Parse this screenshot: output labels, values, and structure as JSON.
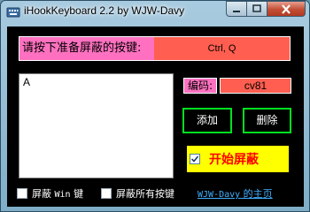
{
  "window": {
    "title": "iHookKeyboard 2.2 by WJW-Davy"
  },
  "titlebar_icons": {
    "min": "minimize-icon",
    "max": "maximize-icon",
    "close": "close-icon"
  },
  "block": {
    "prompt_label": "请按下准备屏蔽的按键:",
    "hotkey_value": "Ctrl, Q"
  },
  "key_list": {
    "items": [
      "A"
    ]
  },
  "code": {
    "label": "编码:",
    "value": "cv81"
  },
  "buttons": {
    "add": "添加",
    "delete": "删除"
  },
  "start": {
    "label": "开始屏蔽",
    "checked": true
  },
  "options": {
    "block_win": {
      "prefix": "屏蔽",
      "win": "Win",
      "suffix": "键",
      "checked": false
    },
    "block_all": {
      "label": "屏蔽所有按键",
      "checked": false
    }
  },
  "homepage": {
    "latin": "WJW-Davy",
    "suffix": "的主页"
  },
  "colors": {
    "accent_pink": "#ff71c0",
    "accent_red": "#ff5e50",
    "button_green": "#00e020",
    "start_yellow": "#ffff00"
  }
}
